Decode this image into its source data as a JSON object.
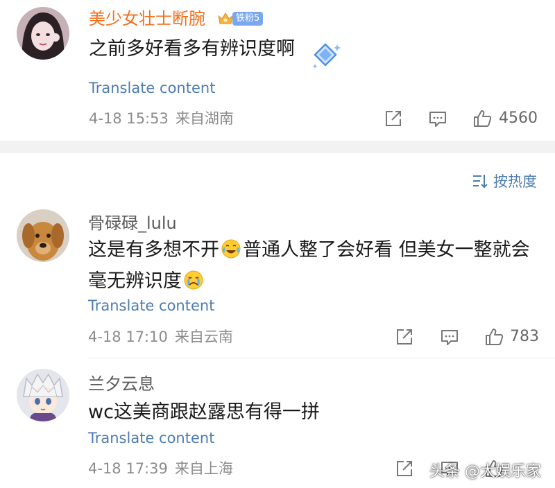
{
  "sort": {
    "label": "按热度"
  },
  "comments": [
    {
      "username": "美少女壮士断腕",
      "badge": "铁粉5",
      "text": "之前多好看多有辨识度啊",
      "translate": "Translate content",
      "date": "4-18 15:53",
      "location": "来自湖南",
      "likes": "4560"
    },
    {
      "username": "骨碌碌_lulu",
      "text_line1_a": "这是有多想不开",
      "text_line1_b": "普通人整了会好看 但美女一整就会",
      "text_line2": "毫无辨识度",
      "translate": "Translate content",
      "date": "4-18 17:10",
      "location": "来自云南",
      "likes": "783"
    },
    {
      "username": "兰夕云息",
      "text": "wc这美商跟赵露思有得一拼",
      "translate": "Translate content",
      "date": "4-18 17:39",
      "location": "来自上海"
    }
  ],
  "watermark": "头条 @大娱乐家",
  "colors": {
    "vip_name": "#f36f1c",
    "link": "#4d7cb0",
    "meta": "#8c8c8c",
    "badge": "#7aa8f0"
  }
}
